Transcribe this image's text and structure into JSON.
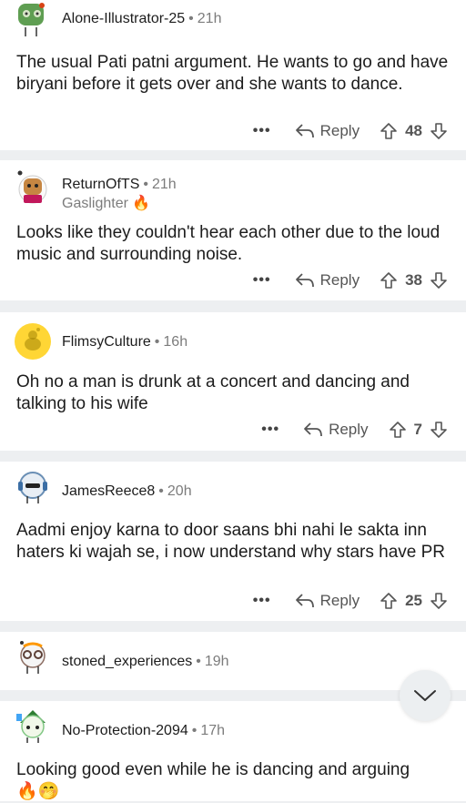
{
  "comments": [
    {
      "username": "Alone-Illustrator-25",
      "sep": "•",
      "time": "21h",
      "flair": "",
      "body": "The usual Pati patni argument. He wants to go and have biryani before it gets over and she wants to dance.",
      "reply_label": "Reply",
      "more_label": "•••",
      "votes": "48",
      "avatar_icon": "green-snoo-avatar-icon"
    },
    {
      "username": "ReturnOfTS",
      "sep": "•",
      "time": "21h",
      "flair": "Gaslighter 🔥",
      "body": "Looks like they couldn't hear each other due to the loud music and surrounding noise.",
      "reply_label": "Reply",
      "more_label": "•••",
      "votes": "38",
      "avatar_icon": "dog-snoo-avatar-icon"
    },
    {
      "username": "FlimsyCulture",
      "sep": "•",
      "time": "16h",
      "flair": "",
      "body": "Oh no a man is drunk at a concert and dancing and talking to his wife",
      "reply_label": "Reply",
      "more_label": "•••",
      "votes": "7",
      "avatar_icon": "yellow-default-avatar-icon"
    },
    {
      "username": "JamesReece8",
      "sep": "•",
      "time": "20h",
      "flair": "",
      "body": "Aadmi enjoy karna to door saans bhi nahi le sakta inn haters ki wajah se, i now understand why stars have PR",
      "reply_label": "Reply",
      "more_label": "•••",
      "votes": "25",
      "avatar_icon": "snoo-headphones-avatar-icon"
    },
    {
      "username": "stoned_experiences",
      "sep": "•",
      "time": "19h",
      "flair": "",
      "body": "",
      "avatar_icon": "snoo-glasses-avatar-icon"
    },
    {
      "username": "No-Protection-2094",
      "sep": "•",
      "time": "17h",
      "flair": "",
      "body": "Looking good even while he is dancing and arguing",
      "emoji_line": "🔥🤭",
      "avatar_icon": "green-hat-snoo-avatar-icon"
    }
  ],
  "scroll_button": {
    "icon": "chevron-down-icon"
  },
  "colors": {
    "background": "#edeff1",
    "card": "#ffffff",
    "meta_gray": "#7c7c7c",
    "flame": "#ff6a14"
  }
}
